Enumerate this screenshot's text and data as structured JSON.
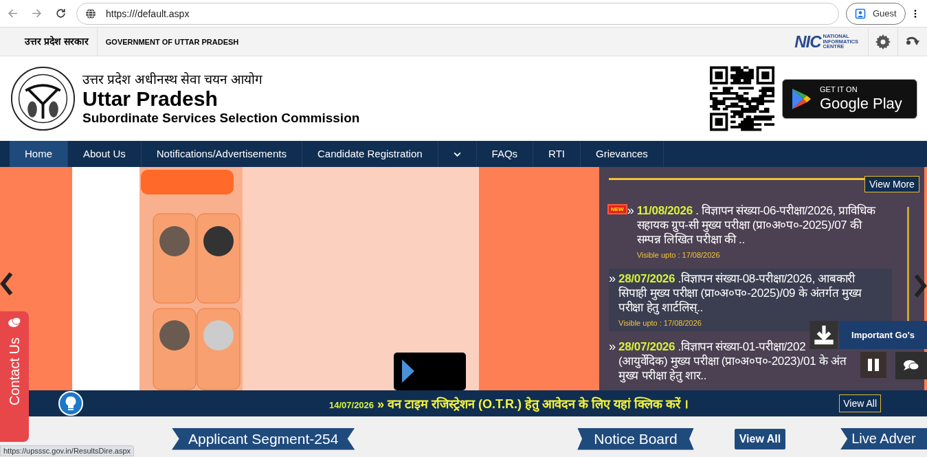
{
  "browser": {
    "url": "https:///default.aspx",
    "profile": "Guest"
  },
  "gov_strip": {
    "hindi": "उत्तर प्रदेश सरकार",
    "english": "GOVERNMENT OF UTTAR PRADESH",
    "nic_mark": "NIC",
    "nic_lines": [
      "NATIONAL",
      "INFORMATICS",
      "CENTRE"
    ]
  },
  "header": {
    "hindi_title": "उत्तर प्रदेश अधीनस्थ सेवा चयन आयोग",
    "title": "Uttar Pradesh",
    "subtitle": "Subordinate Services Selection Commission",
    "badge_small": "GET IT ON",
    "badge_big": "Google Play"
  },
  "nav": [
    {
      "label": "Home",
      "selected": true,
      "kind": "link"
    },
    {
      "label": "About Us",
      "selected": false,
      "kind": "link"
    },
    {
      "label": "Notifications/Advertisements",
      "selected": false,
      "kind": "link"
    },
    {
      "label": "Candidate Registration",
      "selected": false,
      "kind": "link"
    },
    {
      "selected": false,
      "kind": "caret"
    },
    {
      "label": "FAQs",
      "selected": false,
      "kind": "link"
    },
    {
      "label": "RTI",
      "selected": false,
      "kind": "link"
    },
    {
      "label": "Grievances",
      "selected": false,
      "kind": "link"
    }
  ],
  "news": {
    "view_more": "View More",
    "items": [
      {
        "badge": "NEW",
        "marker": "»",
        "highlighted": false,
        "date": "11/08/2026",
        "lines": [
          ". विज्ञापन संख्या-06-परीक्षा/2026, प्राविधिक",
          "सहायक ग्रुप-सी मुख्य परीक्षा (प्रा०अ०प०-2025)/07 की",
          "सम्पन्न लिखित परीक्षा की .."
        ],
        "visible": "Visible upto : 17/08/2026"
      },
      {
        "marker": "»",
        "highlighted": true,
        "date": "28/07/2026",
        "lines": [
          ".विज्ञापन संख्या-08-परीक्षा/2026, आबकारी",
          "सिपाही मुख्य परीक्षा (प्रा०अ०प०-2025)/09 के अंतर्गत मुख्य",
          "परीक्षा हेतु शार्टलिस्.."
        ],
        "visible": "Visible upto : 17/08/2026"
      },
      {
        "marker": "»",
        "highlighted": false,
        "date": "28/07/2026",
        "lines": [
          ".विज्ञापन संख्या-01-परीक्षा/202",
          "(आयुर्वेदिक) मुख्य परीक्षा (प्रा०अ०प०-2023)/01 के अंत",
          "मुख्य परीक्षा हेतु शार.."
        ]
      }
    ]
  },
  "float": {
    "important": "Important Go's"
  },
  "contact": "Contact Us",
  "ticker": {
    "date": "14/07/2026",
    "marker": "»",
    "text": "वन टाइम रजिस्ट्रेशन (O.T.R.) हेतु आवेदन के लिए यहां क्लिक करें ।",
    "button": "View All"
  },
  "sections": [
    {
      "kind": "ribbon",
      "label": "Applicant Segment-254"
    },
    {
      "kind": "ribbon",
      "label": "Notice Board"
    },
    {
      "kind": "button",
      "label": "View All"
    },
    {
      "kind": "ribbon",
      "label": "Live Adver"
    }
  ],
  "status_url": "https://upsssc.gov.in/ResultsDire.aspx"
}
